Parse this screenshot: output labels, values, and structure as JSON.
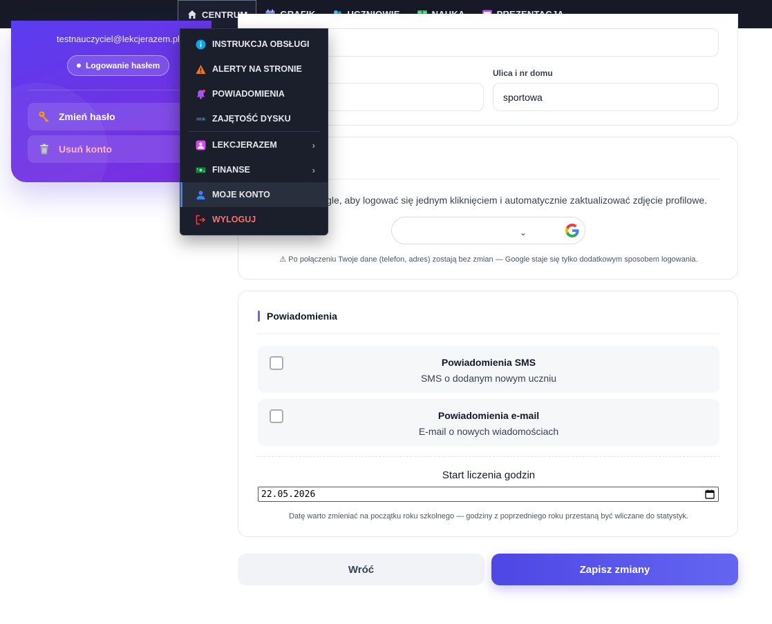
{
  "nav": {
    "items": [
      {
        "label": "CENTRUM",
        "icon": "home-icon"
      },
      {
        "label": "GRAFIK",
        "icon": "calendar-icon"
      },
      {
        "label": "UCZNIOWIE",
        "icon": "users-icon"
      },
      {
        "label": "NAUKA",
        "icon": "book-icon"
      },
      {
        "label": "PREZENTACJA",
        "icon": "presentation-icon"
      }
    ]
  },
  "dropdown": {
    "items": [
      {
        "label": "INSTRUKCJA OBSŁUGI",
        "icon": "info-icon"
      },
      {
        "label": "ALERTY NA STRONIE",
        "icon": "warning-icon"
      },
      {
        "label": "POWIADOMIENIA",
        "icon": "bell-icon"
      },
      {
        "label": "ZAJĘTOŚĆ DYSKU",
        "icon": "disk-icon"
      },
      {
        "label": "LEKCJERAZEM",
        "icon": "app-icon"
      },
      {
        "label": "FINANSE",
        "icon": "money-icon"
      },
      {
        "label": "MOJE KONTO",
        "icon": "user-icon"
      },
      {
        "label": "WYLOGUJ",
        "icon": "logout-icon"
      }
    ]
  },
  "profile": {
    "email": "testnauczyciel@lekcjerazem.pl",
    "login_method": "Logowanie hasłem",
    "change_password": "Zmień hasło",
    "delete_account": "Usuń konto"
  },
  "address": {
    "street_label": "Ulica i nr domu",
    "street_value": "sportowa"
  },
  "google": {
    "text": "Google, aby logować się jednym kliknięciem i automatycznie zaktualizować zdjęcie profilowe.",
    "note": "⚠ Po połączeniu Twoje dane (telefon, adres) zostają bez zmian — Google staje się tylko dodatkowym sposobem logowania."
  },
  "notifications": {
    "title": "Powiadomienia",
    "sms_title": "Powiadomienia SMS",
    "sms_desc": "SMS o dodanym nowym uczniu",
    "email_title": "Powiadomienia e-mail",
    "email_desc": "E-mail o nowych wiadomościach",
    "start_label": "Start liczenia godzin",
    "start_value": "22.05.2026",
    "start_note": "Datę warto zmieniać na początku roku szkolnego — godziny z poprzedniego roku przestaną być wliczane do statystyk."
  },
  "actions": {
    "back": "Wróć",
    "save": "Zapisz zmiany"
  },
  "colors": {
    "accent": "#4f46e5",
    "nav_bg": "#171a26",
    "danger": "#f87171"
  }
}
